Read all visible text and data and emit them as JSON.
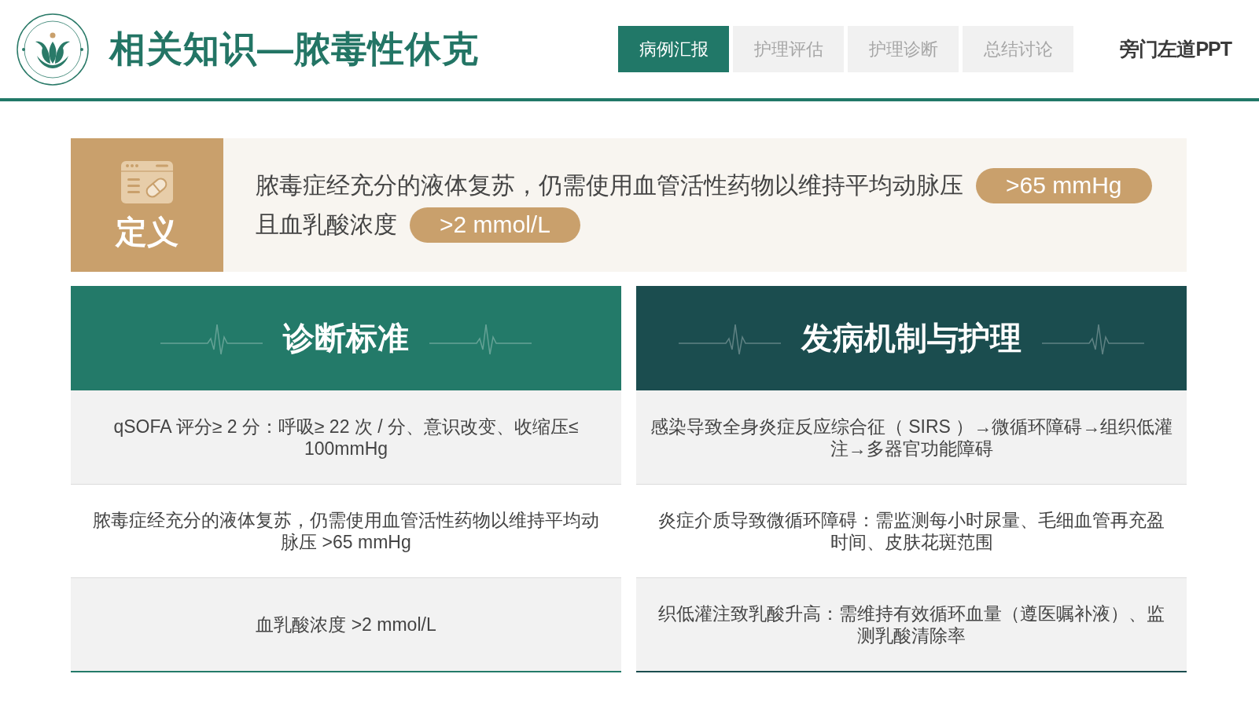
{
  "header": {
    "title": "相关知识—脓毒性休克",
    "tabs": [
      {
        "label": "病例汇报",
        "selected": true
      },
      {
        "label": "护理评估",
        "selected": false
      },
      {
        "label": "护理诊断",
        "selected": false
      },
      {
        "label": "总结讨论",
        "selected": false
      }
    ],
    "brand": "旁门左道PPT"
  },
  "definition": {
    "label": "定义",
    "lines": [
      [
        {
          "kind": "text",
          "text": "脓毒症经充分的液体复苏，仍需使用血管活性药物以维持平均动脉压"
        },
        {
          "kind": "badge",
          "text": ">65 mmHg"
        }
      ],
      [
        {
          "kind": "text",
          "text": "且血乳酸浓度"
        },
        {
          "kind": "badge",
          "text": ">2 mmol/L"
        }
      ]
    ]
  },
  "panels": [
    {
      "title": "诊断标准",
      "color": "#237a69",
      "rows": [
        "qSOFA 评分≥ 2 分：呼吸≥ 22 次 / 分、意识改变、收缩压≤ 100mmHg",
        "脓毒症经充分的液体复苏，仍需使用血管活性药物以维持平均动脉压 >65 mmHg",
        "血乳酸浓度 >2 mmol/L"
      ]
    },
    {
      "title": "发病机制与护理",
      "color": "#1b4d4f",
      "rows": [
        "感染导致全身炎症反应综合征（ SIRS ）→微循环障碍→组织低灌注→多器官功能障碍",
        "炎症介质导致微循环障碍：需监测每小时尿量、毛细血管再充盈时间、皮肤花斑范围",
        "织低灌注致乳酸升高：需维持有效循环血量（遵医嘱补液）、监测乳酸清除率"
      ]
    }
  ]
}
